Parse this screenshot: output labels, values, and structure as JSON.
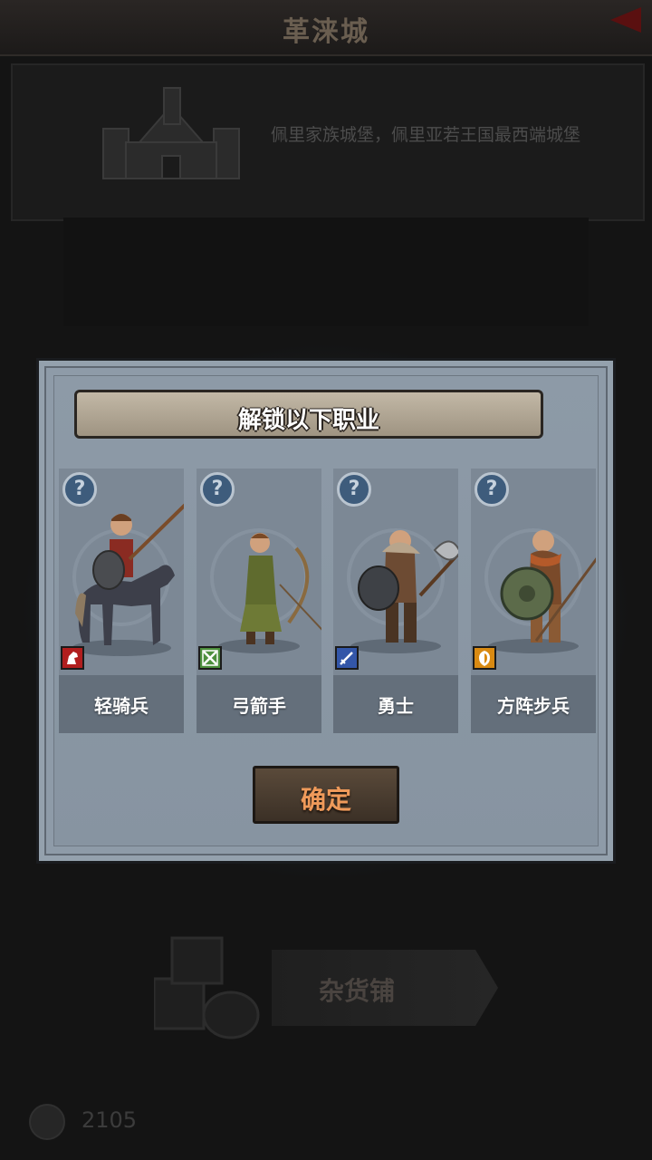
{
  "background": {
    "title": "革涞城",
    "castle_description": "佩里家族城堡，佩里亚若王国最西端城堡",
    "shop_label": "杂货铺",
    "coin_count": "2105"
  },
  "modal": {
    "title": "解锁以下职业",
    "confirm_label": "确定",
    "classes": [
      {
        "name": "轻骑兵",
        "badge_color": "#b11e1e",
        "badge_icon": "horse-icon"
      },
      {
        "name": "弓箭手",
        "badge_color": "#4c8f3c",
        "badge_icon": "crossed-arrows-icon"
      },
      {
        "name": "勇士",
        "badge_color": "#3356a8",
        "badge_icon": "sword-icon"
      },
      {
        "name": "方阵步兵",
        "badge_color": "#d98a12",
        "badge_icon": "shield-icon"
      }
    ],
    "help_glyph": "?"
  }
}
